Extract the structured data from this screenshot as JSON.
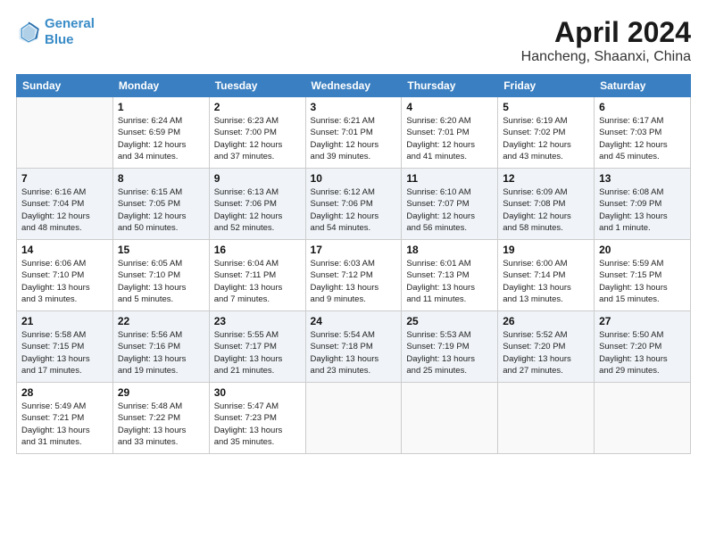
{
  "header": {
    "logo_line1": "General",
    "logo_line2": "Blue",
    "month": "April 2024",
    "location": "Hancheng, Shaanxi, China"
  },
  "weekdays": [
    "Sunday",
    "Monday",
    "Tuesday",
    "Wednesday",
    "Thursday",
    "Friday",
    "Saturday"
  ],
  "weeks": [
    [
      {
        "day": "",
        "info": ""
      },
      {
        "day": "1",
        "info": "Sunrise: 6:24 AM\nSunset: 6:59 PM\nDaylight: 12 hours\nand 34 minutes."
      },
      {
        "day": "2",
        "info": "Sunrise: 6:23 AM\nSunset: 7:00 PM\nDaylight: 12 hours\nand 37 minutes."
      },
      {
        "day": "3",
        "info": "Sunrise: 6:21 AM\nSunset: 7:01 PM\nDaylight: 12 hours\nand 39 minutes."
      },
      {
        "day": "4",
        "info": "Sunrise: 6:20 AM\nSunset: 7:01 PM\nDaylight: 12 hours\nand 41 minutes."
      },
      {
        "day": "5",
        "info": "Sunrise: 6:19 AM\nSunset: 7:02 PM\nDaylight: 12 hours\nand 43 minutes."
      },
      {
        "day": "6",
        "info": "Sunrise: 6:17 AM\nSunset: 7:03 PM\nDaylight: 12 hours\nand 45 minutes."
      }
    ],
    [
      {
        "day": "7",
        "info": "Sunrise: 6:16 AM\nSunset: 7:04 PM\nDaylight: 12 hours\nand 48 minutes."
      },
      {
        "day": "8",
        "info": "Sunrise: 6:15 AM\nSunset: 7:05 PM\nDaylight: 12 hours\nand 50 minutes."
      },
      {
        "day": "9",
        "info": "Sunrise: 6:13 AM\nSunset: 7:06 PM\nDaylight: 12 hours\nand 52 minutes."
      },
      {
        "day": "10",
        "info": "Sunrise: 6:12 AM\nSunset: 7:06 PM\nDaylight: 12 hours\nand 54 minutes."
      },
      {
        "day": "11",
        "info": "Sunrise: 6:10 AM\nSunset: 7:07 PM\nDaylight: 12 hours\nand 56 minutes."
      },
      {
        "day": "12",
        "info": "Sunrise: 6:09 AM\nSunset: 7:08 PM\nDaylight: 12 hours\nand 58 minutes."
      },
      {
        "day": "13",
        "info": "Sunrise: 6:08 AM\nSunset: 7:09 PM\nDaylight: 13 hours\nand 1 minute."
      }
    ],
    [
      {
        "day": "14",
        "info": "Sunrise: 6:06 AM\nSunset: 7:10 PM\nDaylight: 13 hours\nand 3 minutes."
      },
      {
        "day": "15",
        "info": "Sunrise: 6:05 AM\nSunset: 7:10 PM\nDaylight: 13 hours\nand 5 minutes."
      },
      {
        "day": "16",
        "info": "Sunrise: 6:04 AM\nSunset: 7:11 PM\nDaylight: 13 hours\nand 7 minutes."
      },
      {
        "day": "17",
        "info": "Sunrise: 6:03 AM\nSunset: 7:12 PM\nDaylight: 13 hours\nand 9 minutes."
      },
      {
        "day": "18",
        "info": "Sunrise: 6:01 AM\nSunset: 7:13 PM\nDaylight: 13 hours\nand 11 minutes."
      },
      {
        "day": "19",
        "info": "Sunrise: 6:00 AM\nSunset: 7:14 PM\nDaylight: 13 hours\nand 13 minutes."
      },
      {
        "day": "20",
        "info": "Sunrise: 5:59 AM\nSunset: 7:15 PM\nDaylight: 13 hours\nand 15 minutes."
      }
    ],
    [
      {
        "day": "21",
        "info": "Sunrise: 5:58 AM\nSunset: 7:15 PM\nDaylight: 13 hours\nand 17 minutes."
      },
      {
        "day": "22",
        "info": "Sunrise: 5:56 AM\nSunset: 7:16 PM\nDaylight: 13 hours\nand 19 minutes."
      },
      {
        "day": "23",
        "info": "Sunrise: 5:55 AM\nSunset: 7:17 PM\nDaylight: 13 hours\nand 21 minutes."
      },
      {
        "day": "24",
        "info": "Sunrise: 5:54 AM\nSunset: 7:18 PM\nDaylight: 13 hours\nand 23 minutes."
      },
      {
        "day": "25",
        "info": "Sunrise: 5:53 AM\nSunset: 7:19 PM\nDaylight: 13 hours\nand 25 minutes."
      },
      {
        "day": "26",
        "info": "Sunrise: 5:52 AM\nSunset: 7:20 PM\nDaylight: 13 hours\nand 27 minutes."
      },
      {
        "day": "27",
        "info": "Sunrise: 5:50 AM\nSunset: 7:20 PM\nDaylight: 13 hours\nand 29 minutes."
      }
    ],
    [
      {
        "day": "28",
        "info": "Sunrise: 5:49 AM\nSunset: 7:21 PM\nDaylight: 13 hours\nand 31 minutes."
      },
      {
        "day": "29",
        "info": "Sunrise: 5:48 AM\nSunset: 7:22 PM\nDaylight: 13 hours\nand 33 minutes."
      },
      {
        "day": "30",
        "info": "Sunrise: 5:47 AM\nSunset: 7:23 PM\nDaylight: 13 hours\nand 35 minutes."
      },
      {
        "day": "",
        "info": ""
      },
      {
        "day": "",
        "info": ""
      },
      {
        "day": "",
        "info": ""
      },
      {
        "day": "",
        "info": ""
      }
    ]
  ]
}
